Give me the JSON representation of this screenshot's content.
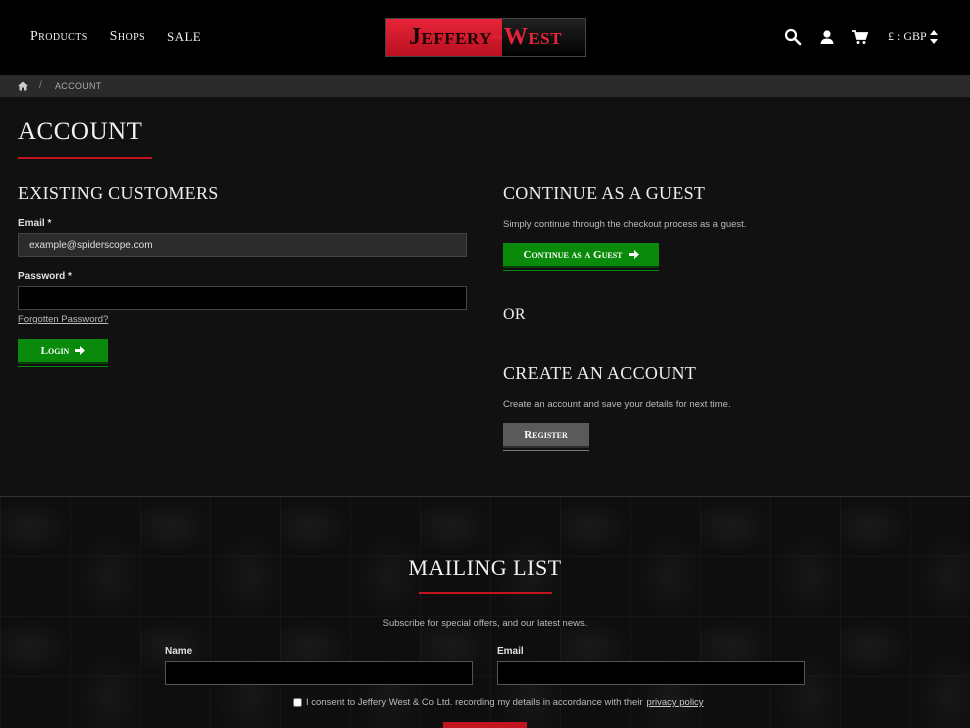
{
  "header": {
    "nav": [
      "Products",
      "Shops",
      "SALE"
    ],
    "logo": {
      "left": "Jeffery",
      "right": "West",
      "separator": "~"
    },
    "icons": [
      "search-icon",
      "user-icon",
      "cart-icon"
    ],
    "currency": "£ : GBP"
  },
  "breadcrumb": {
    "home_icon": "home-icon",
    "separator": "/",
    "current": "ACCOUNT"
  },
  "page": {
    "title": "ACCOUNT"
  },
  "existing": {
    "title": "EXISTING CUSTOMERS",
    "email_label": "Email *",
    "email_value": "example@spiderscope.com",
    "password_label": "Password *",
    "forgot": "Forgotten Password?",
    "login": "Login"
  },
  "guest": {
    "title": "CONTINUE AS A GUEST",
    "desc": "Simply continue through the checkout process as a guest.",
    "button": "Continue as a Guest"
  },
  "or_text": "OR",
  "create": {
    "title": "CREATE AN ACCOUNT",
    "desc": "Create an account and save your details for next time.",
    "button": "Register"
  },
  "mailing": {
    "title": "MAILING LIST",
    "desc": "Subscribe for special offers, and our latest news.",
    "name_label": "Name",
    "email_label": "Email",
    "consent_text": "I consent to Jeffery West & Co Ltd. recording my details in accordance with their",
    "privacy_link": "privacy policy"
  },
  "colors": {
    "accent_red": "#c0151e",
    "green": "#0a8a0a",
    "grey": "#5a5a5a"
  }
}
